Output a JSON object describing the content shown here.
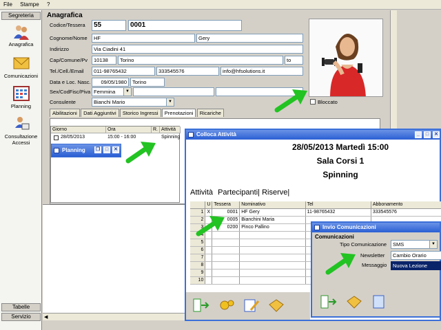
{
  "menu": [
    "File",
    "Stampe",
    "?"
  ],
  "sidebar": {
    "header": "Segreteria",
    "items": [
      {
        "label": "Anagrafica",
        "icon": "users-icon"
      },
      {
        "label": "Comunicazioni",
        "icon": "envelope-icon"
      },
      {
        "label": "Planning",
        "icon": "calendar-grid-icon"
      },
      {
        "label": "Consultazione Accessi",
        "icon": "user-desk-icon"
      }
    ],
    "footer1": "Tabelle",
    "footer2": "Servizio"
  },
  "anagrafica": {
    "title": "Anagrafica",
    "codice_label": "Codice/Tessera",
    "codice": "55",
    "tessera": "0001",
    "cognome_label": "Cognome/Nome",
    "cognome": "HF",
    "nome": "Gery",
    "indirizzo_label": "Indirizzo",
    "indirizzo": "Via Ciadini 41",
    "cap_label": "Cap/Comune/Pv",
    "cap": "10138",
    "comune": "Torino",
    "pv": "to",
    "tel_label": "Tel./Cell./Email",
    "tel": "011-98765432",
    "cell": "333545576",
    "email": "info@hfsolutions.it",
    "data_label": "Data e Loc. Nasc.",
    "data_nasc": "09/05/1980",
    "loc_nasc": "Torino",
    "sex_label": "Sex/CodFisc/Piva",
    "sex": "Femmina",
    "consulente_label": "Consulente",
    "consulente": "Bianchi Mario",
    "bloccato_label": "Bloccato"
  },
  "tabs": [
    "Abilitazioni",
    "Dati Aggiuntivi",
    "Storico Ingressi",
    "Prenotazioni",
    "Ricariche"
  ],
  "prenotazioni": {
    "headers": [
      "Giorno",
      "Ora",
      "R.",
      "Attività"
    ],
    "row": {
      "giorno": "28/05/2013",
      "ora": "15:00 - 16:00",
      "attivita": "Spinning"
    }
  },
  "planning_window": {
    "title": "Planning"
  },
  "colloca": {
    "title": "Colloca Attività",
    "datetime": "28/05/2013 Martedì 15:00",
    "sala": "Sala Corsi 1",
    "corso": "Spinning",
    "tabs": [
      "Attività",
      "Partecipanti",
      "Riserve"
    ],
    "headers": [
      "U",
      "Tessera",
      "Nominativo",
      "Tel",
      "Abbonamento"
    ],
    "rows": [
      {
        "n": "1",
        "u": "X",
        "tessera": "0001",
        "nome": "HF Gery",
        "tel": "11-98765432",
        "tel2": "333545576"
      },
      {
        "n": "2",
        "u": "",
        "tessera": "0005",
        "nome": "Bianchini Maria",
        "tel": "",
        "tel2": ""
      },
      {
        "n": "3",
        "u": "",
        "tessera": "0200",
        "nome": "Pinco Pallino",
        "tel": "",
        "tel2": ""
      },
      {
        "n": "4"
      },
      {
        "n": "5"
      },
      {
        "n": "6"
      },
      {
        "n": "7"
      },
      {
        "n": "8"
      },
      {
        "n": "9"
      },
      {
        "n": "10"
      }
    ]
  },
  "invio": {
    "title": "Invio Comunicazioni",
    "section": "Comunicazioni",
    "tipo_label": "Tipo Comunicazione",
    "tipo": "SMS",
    "newsletter_label": "Newsletter",
    "newsletter": "Cambio Orario",
    "messaggio_label": "Messaggio",
    "messaggio": "Nuova Lezione"
  },
  "colors": {
    "title_blue": "#2a5fd4",
    "arrow_green": "#22c322",
    "selected": "#0a246a"
  }
}
